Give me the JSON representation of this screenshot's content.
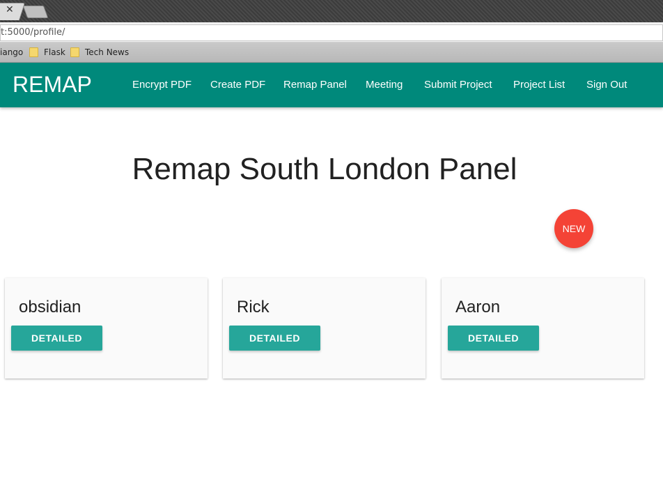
{
  "browser": {
    "tab_close_glyph": "✕",
    "url": "t:5000/profile/",
    "bookmarks": [
      "iango",
      "Flask",
      "Tech News"
    ]
  },
  "navbar": {
    "brand": "REMAP",
    "links": [
      "Encrypt PDF",
      "Create PDF",
      "Remap Panel",
      "Meeting",
      "Submit Project",
      "Project List",
      "Sign Out"
    ],
    "color": "#00897b"
  },
  "main": {
    "title": "Remap South London Panel",
    "fab_label": "NEW",
    "fab_color": "#f44336",
    "cards": [
      {
        "name": "obsidian",
        "button": "DETAILED"
      },
      {
        "name": "Rick",
        "button": "DETAILED"
      },
      {
        "name": "Aaron",
        "button": "DETAILED"
      }
    ],
    "button_color": "#26a69a"
  }
}
